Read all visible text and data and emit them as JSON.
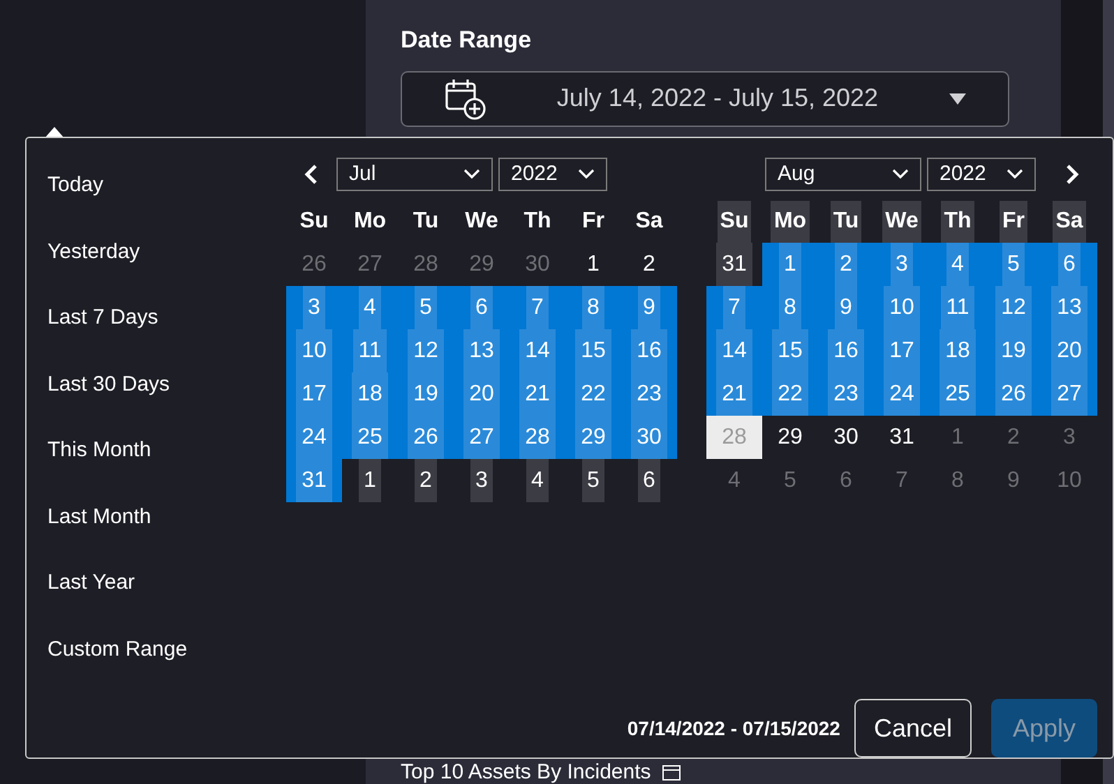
{
  "date_range": {
    "label": "Date Range",
    "value": "July 14, 2022 - July 15, 2022"
  },
  "picker": {
    "ranges": [
      "Today",
      "Yesterday",
      "Last 7 Days",
      "Last 30 Days",
      "This Month",
      "Last Month",
      "Last Year",
      "Custom Range"
    ],
    "calendars": [
      {
        "month": "Jul",
        "year": "2022",
        "headers_shaded": false,
        "weekdays": [
          "Su",
          "Mo",
          "Tu",
          "We",
          "Th",
          "Fr",
          "Sa"
        ],
        "weeks": [
          [
            {
              "label": "26",
              "kind": "muted"
            },
            {
              "label": "27",
              "kind": "muted"
            },
            {
              "label": "28",
              "kind": "muted"
            },
            {
              "label": "29",
              "kind": "muted"
            },
            {
              "label": "30",
              "kind": "muted"
            },
            {
              "label": "1",
              "kind": "plain"
            },
            {
              "label": "2",
              "kind": "plain"
            }
          ],
          [
            {
              "label": "3",
              "kind": "range"
            },
            {
              "label": "4",
              "kind": "range"
            },
            {
              "label": "5",
              "kind": "range"
            },
            {
              "label": "6",
              "kind": "range"
            },
            {
              "label": "7",
              "kind": "range"
            },
            {
              "label": "8",
              "kind": "range"
            },
            {
              "label": "9",
              "kind": "range"
            }
          ],
          [
            {
              "label": "10",
              "kind": "range"
            },
            {
              "label": "11",
              "kind": "range"
            },
            {
              "label": "12",
              "kind": "range"
            },
            {
              "label": "13",
              "kind": "range"
            },
            {
              "label": "14",
              "kind": "range"
            },
            {
              "label": "15",
              "kind": "range"
            },
            {
              "label": "16",
              "kind": "range"
            }
          ],
          [
            {
              "label": "17",
              "kind": "range"
            },
            {
              "label": "18",
              "kind": "range"
            },
            {
              "label": "19",
              "kind": "range"
            },
            {
              "label": "20",
              "kind": "range"
            },
            {
              "label": "21",
              "kind": "range"
            },
            {
              "label": "22",
              "kind": "range"
            },
            {
              "label": "23",
              "kind": "range"
            }
          ],
          [
            {
              "label": "24",
              "kind": "range"
            },
            {
              "label": "25",
              "kind": "range"
            },
            {
              "label": "26",
              "kind": "range"
            },
            {
              "label": "27",
              "kind": "range"
            },
            {
              "label": "28",
              "kind": "range"
            },
            {
              "label": "29",
              "kind": "range"
            },
            {
              "label": "30",
              "kind": "range"
            }
          ],
          [
            {
              "label": "31",
              "kind": "range"
            },
            {
              "label": "1",
              "kind": "shaded"
            },
            {
              "label": "2",
              "kind": "shaded"
            },
            {
              "label": "3",
              "kind": "shaded"
            },
            {
              "label": "4",
              "kind": "shaded"
            },
            {
              "label": "5",
              "kind": "shaded"
            },
            {
              "label": "6",
              "kind": "shaded"
            }
          ]
        ]
      },
      {
        "month": "Aug",
        "year": "2022",
        "headers_shaded": true,
        "weekdays": [
          "Su",
          "Mo",
          "Tu",
          "We",
          "Th",
          "Fr",
          "Sa"
        ],
        "weeks": [
          [
            {
              "label": "31",
              "kind": "shaded"
            },
            {
              "label": "1",
              "kind": "range"
            },
            {
              "label": "2",
              "kind": "range"
            },
            {
              "label": "3",
              "kind": "range"
            },
            {
              "label": "4",
              "kind": "range"
            },
            {
              "label": "5",
              "kind": "range"
            },
            {
              "label": "6",
              "kind": "range"
            }
          ],
          [
            {
              "label": "7",
              "kind": "range"
            },
            {
              "label": "8",
              "kind": "range"
            },
            {
              "label": "9",
              "kind": "range"
            },
            {
              "label": "10",
              "kind": "range"
            },
            {
              "label": "11",
              "kind": "range"
            },
            {
              "label": "12",
              "kind": "range"
            },
            {
              "label": "13",
              "kind": "range"
            }
          ],
          [
            {
              "label": "14",
              "kind": "range"
            },
            {
              "label": "15",
              "kind": "range"
            },
            {
              "label": "16",
              "kind": "range"
            },
            {
              "label": "17",
              "kind": "range"
            },
            {
              "label": "18",
              "kind": "range"
            },
            {
              "label": "19",
              "kind": "range"
            },
            {
              "label": "20",
              "kind": "range"
            }
          ],
          [
            {
              "label": "21",
              "kind": "range"
            },
            {
              "label": "22",
              "kind": "range"
            },
            {
              "label": "23",
              "kind": "range"
            },
            {
              "label": "24",
              "kind": "range"
            },
            {
              "label": "25",
              "kind": "range"
            },
            {
              "label": "26",
              "kind": "range"
            },
            {
              "label": "27",
              "kind": "range"
            }
          ],
          [
            {
              "label": "28",
              "kind": "hover"
            },
            {
              "label": "29",
              "kind": "plain"
            },
            {
              "label": "30",
              "kind": "plain"
            },
            {
              "label": "31",
              "kind": "plain"
            },
            {
              "label": "1",
              "kind": "muted"
            },
            {
              "label": "2",
              "kind": "muted"
            },
            {
              "label": "3",
              "kind": "muted"
            }
          ],
          [
            {
              "label": "4",
              "kind": "muted"
            },
            {
              "label": "5",
              "kind": "muted"
            },
            {
              "label": "6",
              "kind": "muted"
            },
            {
              "label": "7",
              "kind": "muted"
            },
            {
              "label": "8",
              "kind": "muted"
            },
            {
              "label": "9",
              "kind": "muted"
            },
            {
              "label": "10",
              "kind": "muted"
            }
          ]
        ]
      }
    ],
    "selected_range": "07/14/2022 - 07/15/2022",
    "buttons": [
      {
        "label": "Cancel",
        "kind": "outline",
        "disabled": false
      },
      {
        "label": "Apply",
        "kind": "primary",
        "disabled": true
      }
    ]
  },
  "background_widget": {
    "title": "Top 10 Assets By Incidents"
  }
}
